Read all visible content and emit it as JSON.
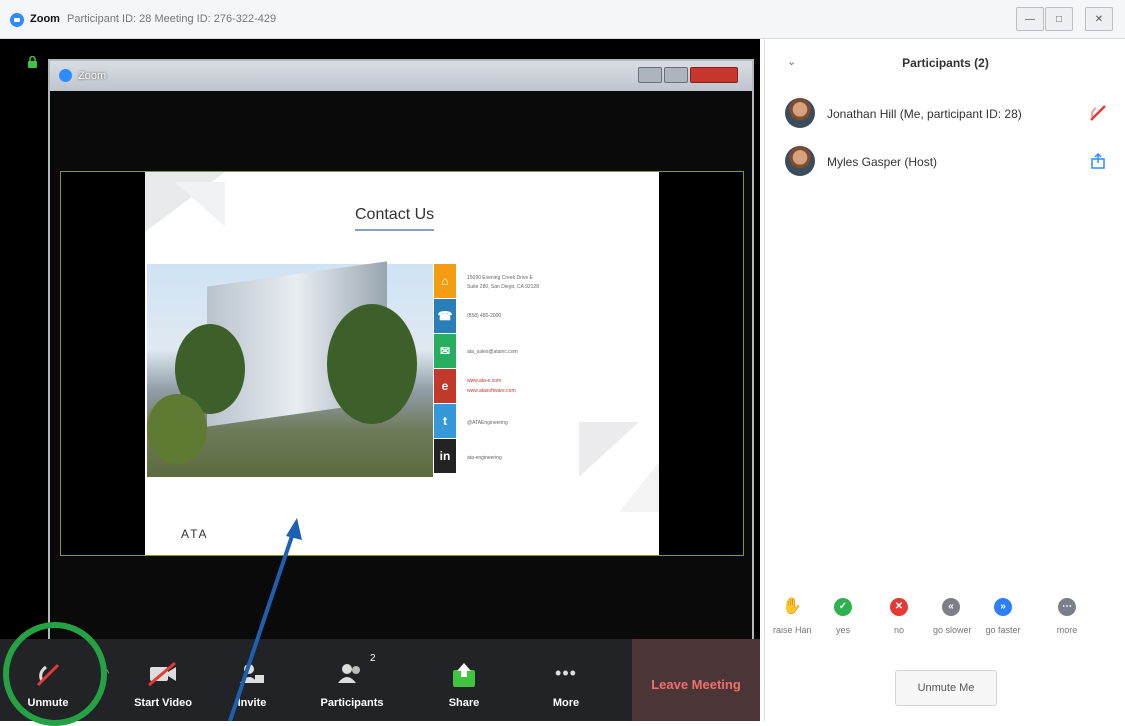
{
  "window": {
    "app_name": "Zoom",
    "meta": "Participant ID: 28   Meeting ID: 276-322-429"
  },
  "inner_window": {
    "title": "Zoom"
  },
  "slide": {
    "heading": "Contact Us",
    "address_line1": "15090 Evening Creek Drive E",
    "address_line2": "Suite 280, San Diego, CA 92128",
    "phone": "(858) 480-2000",
    "email": "ata_sales@atainc.com",
    "web1": "www.ata-e.com",
    "web2": "www.atasoftware.com",
    "twitter": "@ATAEngineering",
    "linkedin": "ata-engineering",
    "logo_text": "ATA"
  },
  "toolbar": {
    "unmute": "Unmute",
    "start_video": "Start Video",
    "invite": "Invite",
    "participants": "Participants",
    "participants_count": "2",
    "share": "Share",
    "more": "More",
    "leave": "Leave Meeting"
  },
  "panel": {
    "title": "Participants (2)",
    "participants": [
      {
        "name": "Jonathan Hill (Me, participant ID: 28)"
      },
      {
        "name": "Myles Gasper (Host)"
      }
    ],
    "feedback": [
      {
        "label": "raise Han",
        "color": "#2d7ff9"
      },
      {
        "label": "yes",
        "color": "#2eb24d"
      },
      {
        "label": "no",
        "color": "#e53935"
      },
      {
        "label": "go slower",
        "color": "#7b7f87"
      },
      {
        "label": "go faster",
        "color": "#2d7ff9"
      },
      {
        "label": "more",
        "color": "#7b7f87"
      }
    ],
    "unmute_me": "Unmute Me"
  },
  "colors": {
    "annotation_circle": "#25a244",
    "annotation_arrow": "#1d5fb0",
    "leave_text": "#ef6f6f",
    "accent": "#2d8cff"
  }
}
